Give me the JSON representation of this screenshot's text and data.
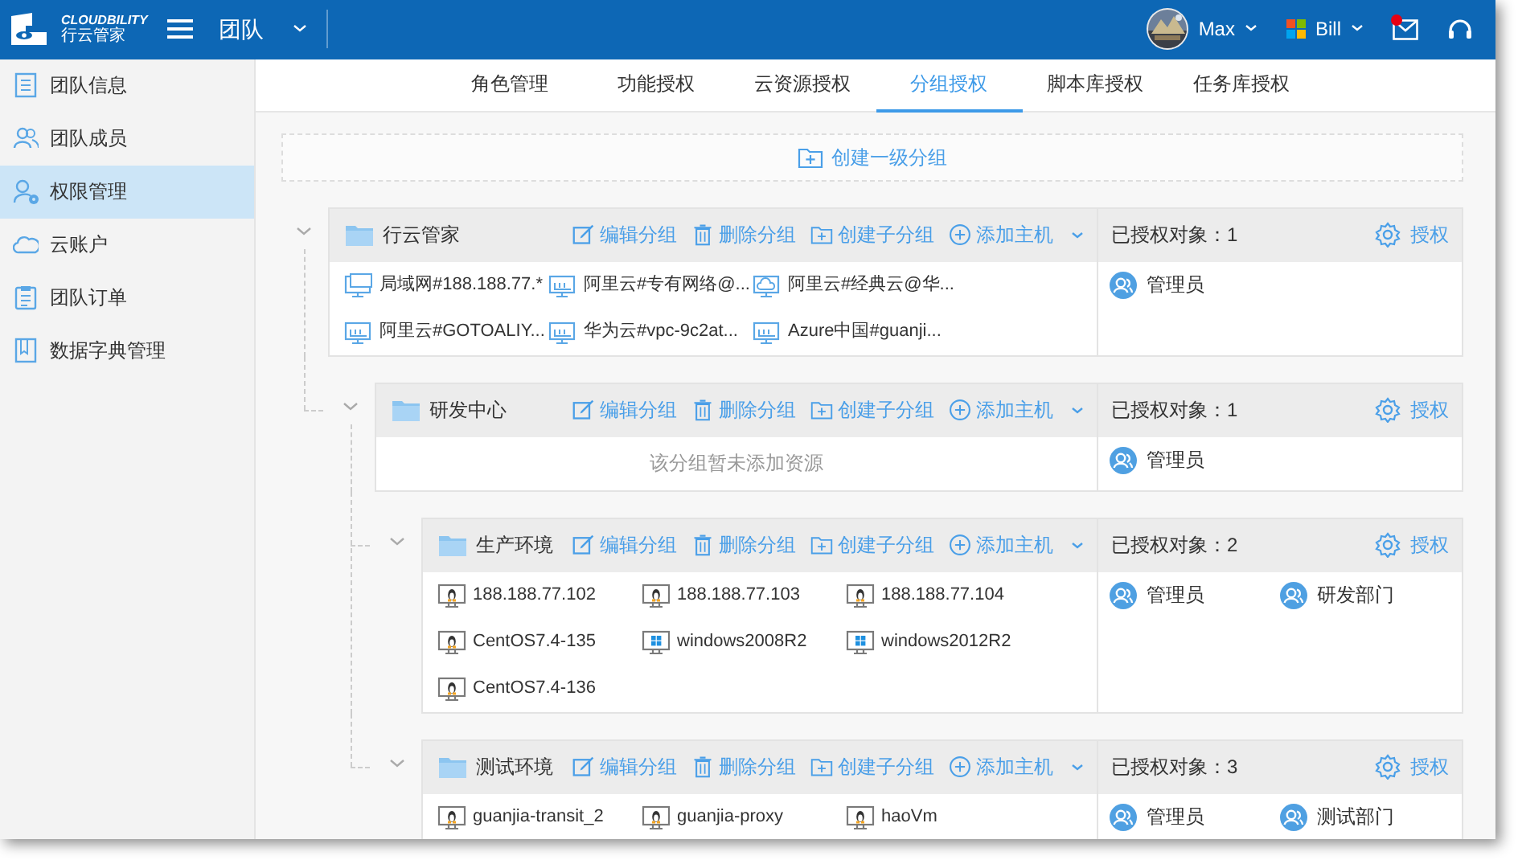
{
  "header": {
    "logo": {
      "title": "CLOUDBILITY",
      "subtitle": "行云管家"
    },
    "team": "团队",
    "user": "Max",
    "account": "Bill",
    "unread": true
  },
  "sidebar": {
    "items": [
      {
        "label": "团队信息",
        "selected": false
      },
      {
        "label": "团队成员",
        "selected": false
      },
      {
        "label": "权限管理",
        "selected": true
      },
      {
        "label": "云账户",
        "selected": false
      },
      {
        "label": "团队订单",
        "selected": false
      },
      {
        "label": "数据字典管理",
        "selected": false
      }
    ]
  },
  "tabs": [
    {
      "label": "角色管理",
      "selected": false
    },
    {
      "label": "功能授权",
      "selected": false
    },
    {
      "label": "云资源授权",
      "selected": false
    },
    {
      "label": "分组授权",
      "selected": true
    },
    {
      "label": "脚本库授权",
      "selected": false
    },
    {
      "label": "任务库授权",
      "selected": false
    }
  ],
  "create_button": "创建一级分组",
  "groups": [
    {
      "name": "行云管家",
      "expanded": true,
      "actions": [
        {
          "kind": "edit",
          "label": "编辑分组"
        },
        {
          "kind": "delete",
          "label": "删除分组"
        },
        {
          "kind": "subgroup",
          "label": "创建子分组"
        },
        {
          "kind": "add_host",
          "label": "添加主机",
          "dropdown": true
        }
      ],
      "authorized_label": "已授权对象：1",
      "authorize_button": "授权",
      "resources": [
        {
          "kind": "lan",
          "name": "局域网#188.188.77.*"
        },
        {
          "kind": "vpc",
          "name": "阿里云#专有网络@..."
        },
        {
          "kind": "classic",
          "name": "阿里云#经典云@华..."
        },
        {
          "kind": "vpc",
          "name": "阿里云#GOTOALIY..."
        },
        {
          "kind": "vpc",
          "name": "华为云#vpc-9c2at..."
        },
        {
          "kind": "vpc",
          "name": "Azure中国#guanji..."
        }
      ],
      "authorized": [
        {
          "name": "管理员"
        }
      ],
      "children": [
        {
          "name": "研发中心",
          "expanded": true,
          "actions": [
            {
              "kind": "edit",
              "label": "编辑分组"
            },
            {
              "kind": "delete",
              "label": "删除分组"
            },
            {
              "kind": "subgroup",
              "label": "创建子分组"
            },
            {
              "kind": "add_host",
              "label": "添加主机",
              "dropdown": true
            }
          ],
          "authorized_label": "已授权对象：1",
          "authorize_button": "授权",
          "empty_text": "该分组暂未添加资源",
          "authorized": [
            {
              "name": "管理员"
            }
          ],
          "children": [
            {
              "name": "生产环境",
              "expanded": true,
              "actions": [
                {
                  "kind": "edit",
                  "label": "编辑分组"
                },
                {
                  "kind": "delete",
                  "label": "删除分组"
                },
                {
                  "kind": "subgroup",
                  "label": "创建子分组"
                },
                {
                  "kind": "add_host",
                  "label": "添加主机",
                  "dropdown": true
                }
              ],
              "authorized_label": "已授权对象：2",
              "authorize_button": "授权",
              "resources": [
                {
                  "kind": "linux",
                  "name": "188.188.77.102"
                },
                {
                  "kind": "linux",
                  "name": "188.188.77.103"
                },
                {
                  "kind": "linux",
                  "name": "188.188.77.104"
                },
                {
                  "kind": "linux",
                  "name": "CentOS7.4-135"
                },
                {
                  "kind": "windows",
                  "name": "windows2008R2"
                },
                {
                  "kind": "windows",
                  "name": "windows2012R2"
                },
                {
                  "kind": "linux",
                  "name": "CentOS7.4-136"
                }
              ],
              "authorized": [
                {
                  "name": "管理员"
                },
                {
                  "name": "研发部门"
                }
              ]
            },
            {
              "name": "测试环境",
              "expanded": true,
              "actions": [
                {
                  "kind": "edit",
                  "label": "编辑分组"
                },
                {
                  "kind": "delete",
                  "label": "删除分组"
                },
                {
                  "kind": "subgroup",
                  "label": "创建子分组"
                },
                {
                  "kind": "add_host",
                  "label": "添加主机",
                  "dropdown": true
                }
              ],
              "authorized_label": "已授权对象：3",
              "authorize_button": "授权",
              "resources": [
                {
                  "kind": "linux",
                  "name": "guanjia-transit_2"
                },
                {
                  "kind": "linux",
                  "name": "guanjia-proxy"
                },
                {
                  "kind": "linux",
                  "name": "haoVm"
                }
              ],
              "authorized": [
                {
                  "name": "管理员"
                },
                {
                  "name": "测试部门"
                }
              ]
            }
          ]
        }
      ]
    }
  ]
}
